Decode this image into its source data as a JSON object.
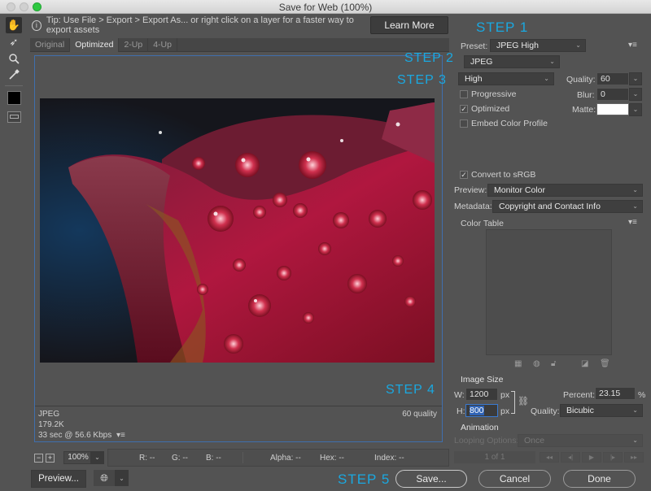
{
  "window": {
    "title": "Save for Web (100%)"
  },
  "tools": [
    {
      "name": "hand-tool",
      "glyph": "✋"
    },
    {
      "name": "slice-select-tool",
      "glyph": "➶"
    },
    {
      "name": "zoom-tool",
      "glyph": "🔍︎"
    },
    {
      "name": "eyedropper-tool",
      "glyph": "✎"
    }
  ],
  "tip": {
    "text": "Tip: Use File > Export > Export As...  or right click on a layer for a faster way to export assets",
    "learn_more": "Learn More"
  },
  "view_tabs": [
    "Original",
    "Optimized",
    "2-Up",
    "4-Up"
  ],
  "active_tab": "Optimized",
  "steps": {
    "s1": "STEP 1",
    "s2": "STEP 2",
    "s3": "STEP 3",
    "s4": "STEP 4",
    "s5": "STEP 5"
  },
  "preview_info": {
    "format": "JPEG",
    "size": "179.2K",
    "speed": "33 sec @ 56.6 Kbps",
    "quality": "60 quality"
  },
  "zoom": {
    "value": "100%",
    "minus": "−",
    "plus": "+"
  },
  "pixel_info": {
    "r": "R: --",
    "g": "G: --",
    "b": "B: --",
    "alpha": "Alpha: --",
    "hex": "Hex: --",
    "index": "Index: --"
  },
  "buttons": {
    "preview": "Preview...",
    "save": "Save...",
    "cancel": "Cancel",
    "done": "Done"
  },
  "settings": {
    "preset_label": "Preset:",
    "preset": "JPEG High",
    "format": "JPEG",
    "compression": "High",
    "quality_label": "Quality:",
    "quality": "60",
    "blur_label": "Blur:",
    "blur": "0",
    "matte_label": "Matte:",
    "matte_color": "#ffffff",
    "progressive": {
      "label": "Progressive",
      "checked": false
    },
    "optimized": {
      "label": "Optimized",
      "checked": true
    },
    "embed_profile": {
      "label": "Embed Color Profile",
      "checked": false
    },
    "convert_srgb": {
      "label": "Convert to sRGB",
      "checked": true
    },
    "preview_label": "Preview:",
    "preview_mode": "Monitor Color",
    "metadata_label": "Metadata:",
    "metadata": "Copyright and Contact Info",
    "color_table_label": "Color Table"
  },
  "image_size": {
    "label": "Image Size",
    "w_label": "W:",
    "width": "1200",
    "h_label": "H:",
    "height": "800",
    "unit": "px",
    "percent_label": "Percent:",
    "percent": "23.15",
    "percent_unit": "%",
    "quality_label": "Quality:",
    "quality": "Bicubic"
  },
  "animation": {
    "label": "Animation",
    "looping_label": "Looping Options:",
    "looping": "Once",
    "frame": "1 of 1"
  },
  "colors": {
    "accent_step": "#1aa8e0",
    "frame_border": "#3f6fae",
    "panel_bg": "#535353"
  }
}
